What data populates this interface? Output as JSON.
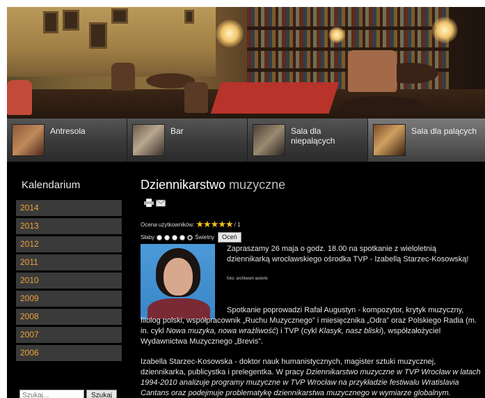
{
  "tabs": [
    {
      "label": "Antresola",
      "active": false
    },
    {
      "label": "Bar",
      "active": false
    },
    {
      "label": "Sala dla niepalących",
      "active": false
    },
    {
      "label": "Sala dla palących",
      "active": true
    }
  ],
  "sidebar": {
    "title": "Kalendarium",
    "years": [
      "2014",
      "2013",
      "2012",
      "2011",
      "2010",
      "2009",
      "2008",
      "2007",
      "2006"
    ],
    "search_placeholder": "Szukaj...",
    "search_button": "Szukaj"
  },
  "article": {
    "title_part1": "Dziennikarstwo",
    "title_part2": "muzyczne",
    "rating_label": "Ocena użytkowników:",
    "rating_stars": 5,
    "rating_count": "/ 1",
    "vote_low": "Słaby",
    "vote_high": "Świetny",
    "vote_button": "Oceń",
    "lead": "Zapraszamy 26 maja o godz. 18.00 na spotkanie z wieloletnią dziennikarką wrocławskiego ośrodka TVP - Izabellą Starzec-Kosowską!",
    "photo_caption": "foto: archiwum autorki",
    "para2_a": "Spotkanie poprowadzi Rafał Augustyn - kompozytor, krytyk muzyczny, filolog polski, współpracownik „Ruchu Muzycznego” i miesięcznika „Odra” oraz Polskiego Radia (m. in. cykl ",
    "para2_i1": "Nowa muzyka, nowa wrażliwość",
    "para2_b": ") i TVP (cykl ",
    "para2_i2": "Klasyk, nasz bliski",
    "para2_c": "), współzałożyciel Wydawnictwa Muzycznego „Brevis”.",
    "para3_a": "Izabella Starzec-Kosowska - doktor nauk humanistycznych, magister sztuki muzycznej, dziennikarka, publicystka i prelegentka. W pracy ",
    "para3_i": "Dziennikarstwo muzyczne w TVP Wrocław w latach 1994-2010 analizuje programy muzyczne w TVP Wrocław na przykładzie festiwalu Wratislavia Cantans oraz podejmuje problematykę dziennikarstwa muzycznego w wymiarze globalnym."
  },
  "colors": {
    "background": "#000000",
    "year_text": "#f0a23c",
    "year_bg": "#3a3a3a",
    "star": "#f4c21a"
  },
  "icons": [
    "print-icon",
    "email-icon",
    "star-icon"
  ]
}
